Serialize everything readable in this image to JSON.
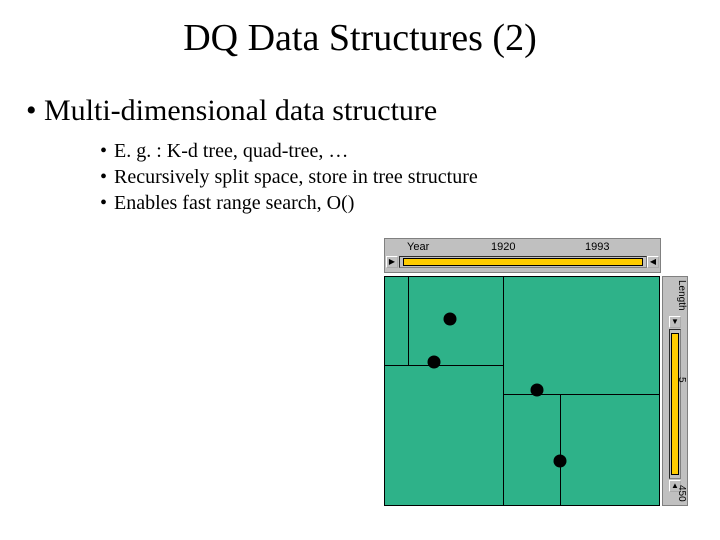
{
  "title": "DQ Data Structures (2)",
  "bullets": {
    "l1": "Multi-dimensional data structure",
    "l2a": "E. g. : K-d tree, quad-tree, …",
    "l2b": "Recursively split space, store in tree structure",
    "l2c": "Enables fast range search,  O()"
  },
  "hslider": {
    "label": "Year",
    "min": "1920",
    "max": "1993",
    "arrow_l": "▶",
    "arrow_r": "◀"
  },
  "vslider": {
    "label": "Length",
    "min": "5",
    "max": "450",
    "arrow_t": "▼",
    "arrow_b": "▲"
  }
}
